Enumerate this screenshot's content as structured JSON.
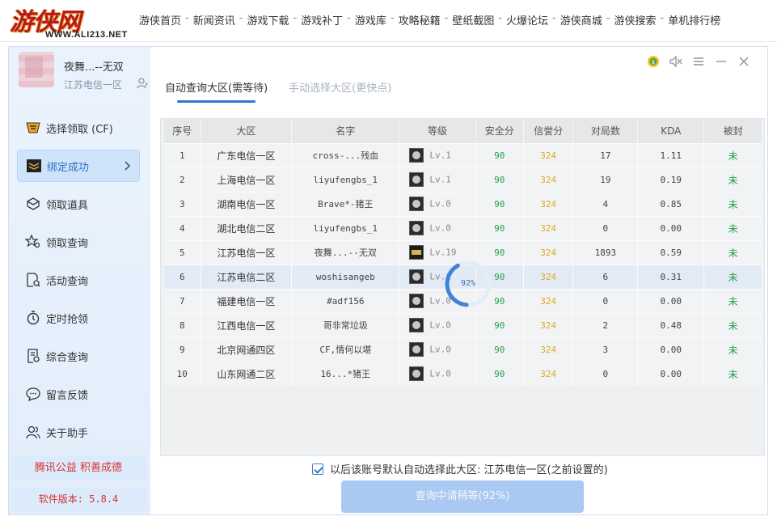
{
  "site": {
    "logo_text": "游侠网",
    "logo_url_text": "WWW.ALI213.NET",
    "nav": [
      "游侠首页",
      "新闻资讯",
      "游戏下载",
      "游戏补丁",
      "游戏库",
      "攻略秘籍",
      "壁纸截图",
      "火爆论坛",
      "游侠商城",
      "游侠搜索",
      "单机排行榜"
    ],
    "nav_sep": "-"
  },
  "user": {
    "name": "夜舞...--无双",
    "server": "江苏电信一区"
  },
  "sidebar": {
    "items": [
      {
        "label": "选择领取 (CF)",
        "icon": "cf-logo-icon"
      },
      {
        "label": "绑定成功",
        "icon": "bind-card-icon",
        "active": true
      },
      {
        "label": "领取道具",
        "icon": "box-icon"
      },
      {
        "label": "领取查询",
        "icon": "star-search-icon"
      },
      {
        "label": "活动查询",
        "icon": "doc-search-icon"
      },
      {
        "label": "定时抢领",
        "icon": "timer-icon"
      },
      {
        "label": "综合查询",
        "icon": "report-icon"
      },
      {
        "label": "留言反馈",
        "icon": "chat-icon"
      },
      {
        "label": "关于助手",
        "icon": "users-icon"
      }
    ],
    "promo": "腾讯公益 积善成德",
    "version": "软件版本: 5.8.4"
  },
  "tabs": [
    {
      "label": "自动查询大区(需等待)",
      "active": true
    },
    {
      "label": "手动选择大区(更快点)",
      "active": false
    }
  ],
  "table": {
    "headers": [
      "序号",
      "大区",
      "名字",
      "等级",
      "安全分",
      "信誉分",
      "对局数",
      "KDA",
      "被封"
    ],
    "rows": [
      {
        "no": "1",
        "region": "广东电信一区",
        "name": "cross-...残血",
        "level": "Lv.1",
        "safe": "90",
        "credit": "324",
        "games": "17",
        "kda": "1.11",
        "banned": "未"
      },
      {
        "no": "2",
        "region": "上海电信一区",
        "name": "liyufengbs_1",
        "level": "Lv.1",
        "safe": "90",
        "credit": "324",
        "games": "19",
        "kda": "0.19",
        "banned": "未"
      },
      {
        "no": "3",
        "region": "湖南电信一区",
        "name": "Brave*-猪王",
        "level": "Lv.0",
        "safe": "90",
        "credit": "324",
        "games": "4",
        "kda": "0.85",
        "banned": "未"
      },
      {
        "no": "4",
        "region": "湖北电信二区",
        "name": "liyufengbs_1",
        "level": "Lv.0",
        "safe": "90",
        "credit": "324",
        "games": "0",
        "kda": "0.00",
        "banned": "未"
      },
      {
        "no": "5",
        "region": "江苏电信一区",
        "name": "夜舞...--无双",
        "level": "Lv.19",
        "safe": "90",
        "credit": "324",
        "games": "1893",
        "kda": "0.59",
        "banned": "未"
      },
      {
        "no": "6",
        "region": "江苏电信二区",
        "name": "woshisangeb",
        "level": "Lv.1",
        "safe": "90",
        "credit": "324",
        "games": "6",
        "kda": "0.31",
        "banned": "未"
      },
      {
        "no": "7",
        "region": "福建电信一区",
        "name": "#adf156",
        "level": "Lv.0",
        "safe": "90",
        "credit": "324",
        "games": "0",
        "kda": "0.00",
        "banned": "未"
      },
      {
        "no": "8",
        "region": "江西电信一区",
        "name": "哥非常垃圾",
        "level": "Lv.0",
        "safe": "90",
        "credit": "324",
        "games": "2",
        "kda": "0.48",
        "banned": "未"
      },
      {
        "no": "9",
        "region": "北京网通四区",
        "name": "CF,情何以堪",
        "level": "Lv.0",
        "safe": "90",
        "credit": "324",
        "games": "3",
        "kda": "0.00",
        "banned": "未"
      },
      {
        "no": "10",
        "region": "山东网通二区",
        "name": "16...*猪王",
        "level": "Lv.0",
        "safe": "90",
        "credit": "324",
        "games": "0",
        "kda": "0.00",
        "banned": "未"
      }
    ],
    "selected_row": 6
  },
  "progress": {
    "value": 0.92,
    "text": "92%"
  },
  "remember": {
    "checked": true,
    "label": "以后该账号默认自动选择此大区: 江苏电信一区(之前设置的)"
  },
  "query_button": "查询中请稍等(92%)",
  "colors": {
    "accent": "#2e79d2",
    "safe": "#24a14a",
    "credit": "#e0a91b",
    "promo": "#d8312c"
  }
}
